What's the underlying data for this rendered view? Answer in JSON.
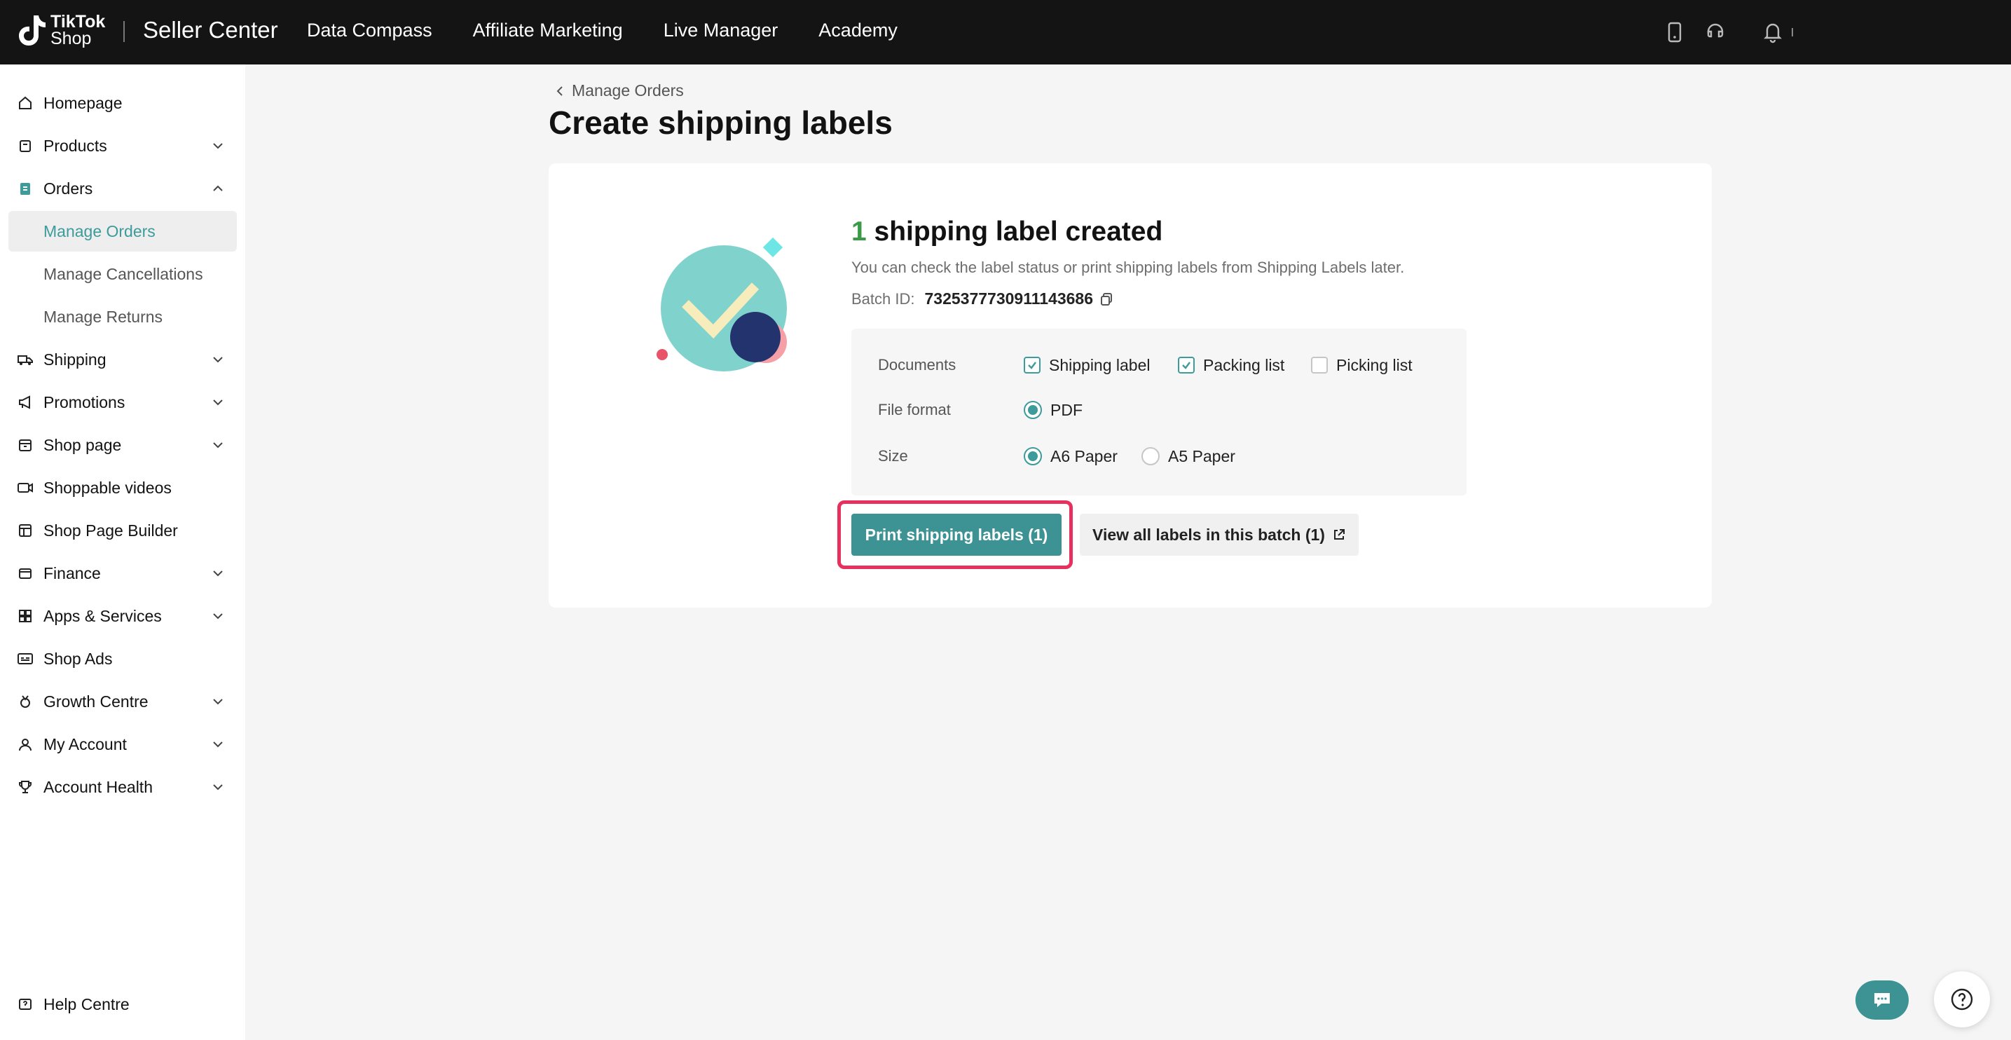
{
  "topbar": {
    "logo_line1": "TikTok",
    "logo_line2": "Shop",
    "app_title": "Seller Center",
    "nav": [
      "Data Compass",
      "Affiliate Marketing",
      "Live Manager",
      "Academy"
    ],
    "icons": [
      "phone-icon",
      "headset-icon",
      "bell-icon"
    ]
  },
  "sidebar": {
    "items": [
      {
        "label": "Homepage",
        "icon": "home-icon"
      },
      {
        "label": "Products",
        "icon": "box-icon"
      },
      {
        "label": "Orders",
        "icon": "clipboard-icon"
      },
      {
        "label": "Manage Orders"
      },
      {
        "label": "Manage Cancellations"
      },
      {
        "label": "Manage Returns"
      },
      {
        "label": "Shipping",
        "icon": "truck-icon"
      },
      {
        "label": "Promotions",
        "icon": "megaphone-icon"
      },
      {
        "label": "Shop page",
        "icon": "store-icon"
      },
      {
        "label": "Shoppable videos",
        "icon": "video-icon"
      },
      {
        "label": "Shop Page Builder",
        "icon": "builder-icon"
      },
      {
        "label": "Finance",
        "icon": "wallet-icon"
      },
      {
        "label": "Apps & Services",
        "icon": "apps-icon"
      },
      {
        "label": "Shop Ads",
        "icon": "ads-icon"
      },
      {
        "label": "Growth Centre",
        "icon": "medal-icon"
      },
      {
        "label": "My Account",
        "icon": "user-icon"
      },
      {
        "label": "Account Health",
        "icon": "trophy-icon"
      }
    ],
    "help": "Help Centre"
  },
  "main": {
    "breadcrumb": "Manage Orders",
    "title": "Create shipping labels",
    "result": {
      "count": "1",
      "title_rest": " shipping label created",
      "description": "You can check the label status or print shipping labels from Shipping Labels later.",
      "batch_label": "Batch ID:",
      "batch_id": "7325377730911143686"
    },
    "options": {
      "documents_label": "Documents",
      "documents": [
        "Shipping label",
        "Packing list",
        "Picking list"
      ],
      "documents_checked": [
        true,
        true,
        false
      ],
      "format_label": "File format",
      "format": "PDF",
      "size_label": "Size",
      "sizes": [
        "A6 Paper",
        "A5 Paper"
      ],
      "size_selected": "A6 Paper"
    },
    "print_button": "Print shipping labels (1)",
    "view_button": "View all labels in this batch (1)"
  },
  "colors": {
    "accent": "#3d9393",
    "highlight": "#e8305f",
    "success": "#3a9a47"
  }
}
